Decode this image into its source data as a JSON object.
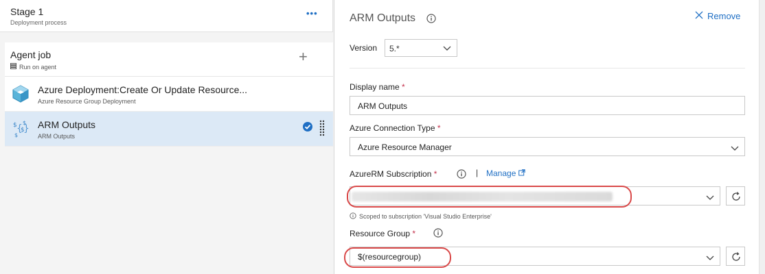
{
  "stage": {
    "title": "Stage 1",
    "subtitle": "Deployment process",
    "more_label": "•••"
  },
  "agent_job": {
    "title": "Agent job",
    "subtitle": "Run on agent",
    "add_label": "+"
  },
  "tasks": [
    {
      "title": "Azure Deployment:Create Or Update Resource...",
      "subtitle": "Azure Resource Group Deployment",
      "icon": "azure-cube-icon",
      "selected": false
    },
    {
      "title": "ARM Outputs",
      "subtitle": "ARM Outputs",
      "icon": "arm-outputs-icon",
      "selected": true
    }
  ],
  "panel": {
    "title": "ARM Outputs",
    "remove_label": "Remove",
    "version_label": "Version",
    "version_value": "5.*",
    "display_name_label": "Display name",
    "display_name_value": "ARM Outputs",
    "connection_type_label": "Azure Connection Type",
    "connection_type_value": "Azure Resource Manager",
    "subscription_label": "AzureRM Subscription",
    "manage_label": "Manage",
    "pipe": "|",
    "subscription_note": "Scoped to subscription 'Visual Studio Enterprise'",
    "resource_group_label": "Resource Group",
    "resource_group_value": "$(resourcegroup)",
    "required_mark": "*"
  },
  "colors": {
    "accent": "#1f6fc4",
    "selected_row": "#dce9f6",
    "highlight": "#d94848"
  }
}
